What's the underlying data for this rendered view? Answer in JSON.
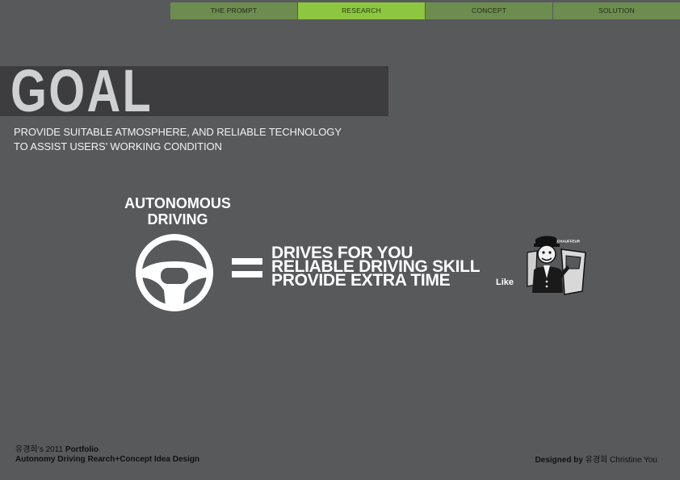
{
  "nav": {
    "items": [
      {
        "label": "THE PROMPT"
      },
      {
        "label": "RESEARCH"
      },
      {
        "label": "CONCEPT"
      },
      {
        "label": "SOLUTION"
      }
    ],
    "active": "RESEARCH"
  },
  "goal": {
    "title": "GOAL",
    "description_line1": "PROVIDE SUITABLE ATMOSPHERE,  AND RELIABLE TECHNOLOGY",
    "description_line2": "TO ASSIST USERS’ WORKING CONDITION"
  },
  "concept": {
    "label_line1": "AUTONOMOUS",
    "label_line2": "DRIVING",
    "benefits": [
      "DRIVES FOR YOU",
      "RELIABLE DRIVING SKILL",
      "PROVIDE EXTRA TIME"
    ],
    "like": "Like",
    "chauffeur_sign": "CHAUFFEUR"
  },
  "footer": {
    "author_kr": "유경희",
    "portfolio_suffix": "’s 2011 ",
    "portfolio_word": "Portfolio",
    "subtitle": "Autonomy Driving Rearch+Concept Idea Design",
    "designed_by": "Designed by ",
    "designer": "유경희 Christine You"
  },
  "colors": {
    "background": "#58595b",
    "nav": "#6d8c4f",
    "nav_active": "#8dc63f",
    "goal_band": "#3d3d3f"
  }
}
